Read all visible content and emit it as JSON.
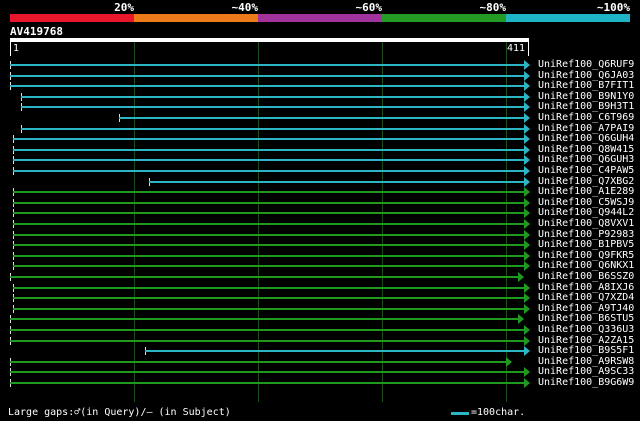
{
  "colors": {
    "band": [
      "#e8172b",
      "#ee7b1a",
      "#a2339d",
      "#239a23",
      "#1fb3c6"
    ],
    "hit_cyan": "#2bb5c5",
    "hit_green": "#1f9a1f"
  },
  "header": {
    "percent_labels": [
      "20%",
      "~40%",
      "~60%",
      "~80%",
      "~100%"
    ]
  },
  "query": {
    "id": "AV419768",
    "start_label": "1",
    "end_label": "411",
    "length": 411
  },
  "hits": [
    {
      "label": "UniRef100_Q6RUF9",
      "color": "cyan",
      "start": 1,
      "end": 411,
      "arrow": true
    },
    {
      "label": "UniRef100_Q6JA03",
      "color": "cyan",
      "start": 1,
      "end": 411,
      "arrow": true
    },
    {
      "label": "UniRef100_B7FIT1",
      "color": "cyan",
      "start": 1,
      "end": 411,
      "arrow": true
    },
    {
      "label": "UniRef100_B9N1Y0",
      "color": "cyan",
      "start": 10,
      "end": 411,
      "arrow": true
    },
    {
      "label": "UniRef100_B9H3T1",
      "color": "cyan",
      "start": 10,
      "end": 411,
      "arrow": true
    },
    {
      "label": "UniRef100_C6T969",
      "color": "cyan",
      "start": 87,
      "end": 411,
      "arrow": true
    },
    {
      "label": "UniRef100_A7PAI9",
      "color": "cyan",
      "start": 10,
      "end": 411,
      "arrow": true
    },
    {
      "label": "UniRef100_Q6GUH4",
      "color": "cyan",
      "start": 3,
      "end": 411,
      "arrow": true
    },
    {
      "label": "UniRef100_Q8W415",
      "color": "cyan",
      "start": 3,
      "end": 411,
      "arrow": true
    },
    {
      "label": "UniRef100_Q6GUH3",
      "color": "cyan",
      "start": 3,
      "end": 411,
      "arrow": true
    },
    {
      "label": "UniRef100_C4PAW5",
      "color": "cyan",
      "start": 3,
      "end": 411,
      "arrow": true
    },
    {
      "label": "UniRef100_Q7XBG2",
      "color": "cyan",
      "start": 111,
      "end": 411,
      "arrow": true
    },
    {
      "label": "UniRef100_A1E289",
      "color": "green",
      "start": 3,
      "end": 411,
      "arrow": true
    },
    {
      "label": "UniRef100_C5WSJ9",
      "color": "green",
      "start": 3,
      "end": 411,
      "arrow": true
    },
    {
      "label": "UniRef100_Q944L2",
      "color": "green",
      "start": 3,
      "end": 411,
      "arrow": true
    },
    {
      "label": "UniRef100_Q8VXV1",
      "color": "green",
      "start": 3,
      "end": 411,
      "arrow": true
    },
    {
      "label": "UniRef100_P92983",
      "color": "green",
      "start": 3,
      "end": 411,
      "arrow": true
    },
    {
      "label": "UniRef100_B1PBV5",
      "color": "green",
      "start": 3,
      "end": 411,
      "arrow": true
    },
    {
      "label": "UniRef100_Q9FKR5",
      "color": "green",
      "start": 3,
      "end": 411,
      "arrow": true
    },
    {
      "label": "UniRef100_Q6NKX1",
      "color": "green",
      "start": 3,
      "end": 411,
      "arrow": true
    },
    {
      "label": "UniRef100_B6SSZ0",
      "color": "green",
      "start": 1,
      "end": 406,
      "arrow": true
    },
    {
      "label": "UniRef100_A8IXJ6",
      "color": "green",
      "start": 3,
      "end": 411,
      "arrow": true
    },
    {
      "label": "UniRef100_Q7XZD4",
      "color": "green",
      "start": 3,
      "end": 411,
      "arrow": true
    },
    {
      "label": "UniRef100_A9TJ40",
      "color": "green",
      "start": 3,
      "end": 411,
      "arrow": true
    },
    {
      "label": "UniRef100_B6STU5",
      "color": "green",
      "start": 1,
      "end": 406,
      "arrow": true
    },
    {
      "label": "UniRef100_Q336U3",
      "color": "green",
      "start": 1,
      "end": 411,
      "arrow": true
    },
    {
      "label": "UniRef100_A2ZA15",
      "color": "green",
      "start": 1,
      "end": 411,
      "arrow": true
    },
    {
      "label": "UniRef100_B9S5F1",
      "color": "cyan",
      "start": 108,
      "end": 411,
      "arrow": true
    },
    {
      "label": "UniRef100_A9RSW8",
      "color": "green",
      "start": 1,
      "end": 397,
      "arrow": true
    },
    {
      "label": "UniRef100_A9SC33",
      "color": "green",
      "start": 1,
      "end": 411,
      "arrow": true
    },
    {
      "label": "UniRef100_B9G6W9",
      "color": "green",
      "start": 1,
      "end": 411,
      "arrow": true
    }
  ],
  "footer": {
    "gaps_text": "Large gaps:♂(in Query)/– (in Subject)",
    "legend_text": "=100char."
  }
}
